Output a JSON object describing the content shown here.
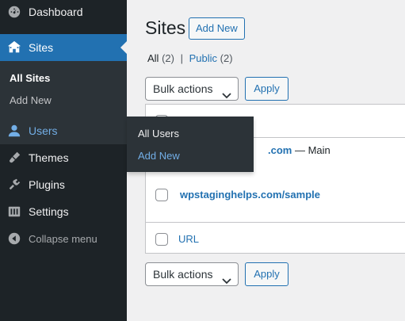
{
  "sidebar": {
    "dashboard": "Dashboard",
    "sites": "Sites",
    "sites_submenu": [
      "All Sites",
      "Add New"
    ],
    "users": "Users",
    "themes": "Themes",
    "plugins": "Plugins",
    "settings": "Settings",
    "collapse": "Collapse menu"
  },
  "flyout": [
    "All Users",
    "Add New"
  ],
  "page": {
    "title": "Sites",
    "add_new": "Add New",
    "views": {
      "all_label": "All",
      "all_count": "(2)",
      "sep": "|",
      "public_label": "Public",
      "public_count": "(2)"
    }
  },
  "bulk_top": {
    "value": "Bulk actions",
    "apply": "Apply"
  },
  "bulk_bottom": {
    "value": "Bulk actions",
    "apply": "Apply"
  },
  "table": {
    "rows": [
      {
        "url_visible": ".com",
        "suffix": " — Main"
      },
      {
        "url": "wpstaginghelps.com/sample"
      }
    ],
    "footer": "URL"
  },
  "icons": {
    "dashboard": "dashboard-icon",
    "sites": "sites-icon",
    "users": "users-icon",
    "themes": "themes-icon",
    "plugins": "plugins-icon",
    "settings": "settings-icon",
    "collapse": "collapse-icon"
  },
  "colors": {
    "accent": "#2271b1",
    "sidebar_bg": "#1d2327",
    "submenu_bg": "#2c3338",
    "link_hover": "#72aee6"
  }
}
